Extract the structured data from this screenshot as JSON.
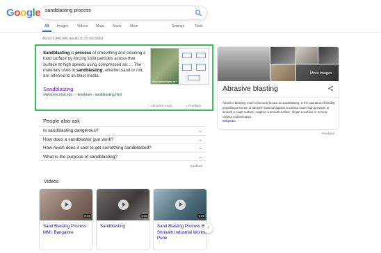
{
  "header": {
    "logo": [
      "G",
      "o",
      "o",
      "g",
      "l",
      "e"
    ],
    "search_value": "sandblasting process",
    "search_icon": "search-icon"
  },
  "tabs": [
    {
      "label": "All",
      "active": true
    },
    {
      "label": "Images"
    },
    {
      "label": "Videos"
    },
    {
      "label": "Maps"
    },
    {
      "label": "News"
    },
    {
      "label": "More"
    },
    {
      "label": "Settings"
    },
    {
      "label": "Tools"
    }
  ],
  "results_count": "About 6,840,000 results (0.39 seconds)",
  "snippet": {
    "image_caption": "www.researchgate.net",
    "title": "Sandblasting",
    "url": "www.princeton.edu › ~timeteam › sandblasting.html",
    "about": "About this result",
    "feedback": "Feedback"
  },
  "people_also_ask": {
    "title": "People also ask",
    "questions": [
      "Is sandblasting dangerous?",
      "How does a sandblaster gun work?",
      "How much does it cost to get something sandblasted?",
      "What is the purpose of sandblasting?"
    ],
    "feedback": "Feedback"
  },
  "knowledge_panel": {
    "more_images": "More images",
    "title": "Abrasive blasting",
    "share_icon": "share-icon",
    "description": "Abrasive blasting, more commonly known as sandblasting, is the operation of forcibly propelling a stream of abrasive material against a surface under high pressure to smooth a rough surface, roughen a smooth surface, shape a surface or remove surface contaminants.",
    "source": "Wikipedia",
    "feedback": "Feedback"
  },
  "videos": {
    "title": "Videos",
    "items": [
      {
        "title": "Sand Blasting Process MMI, Bangalore",
        "duration": "0:48"
      },
      {
        "title": "Sandblasting",
        "duration": "2:34"
      },
      {
        "title": "Sand Blasting Process By Shrinath Industrial Works, Pune",
        "duration": "1:29"
      }
    ],
    "next_icon": "chevron-right-icon"
  }
}
